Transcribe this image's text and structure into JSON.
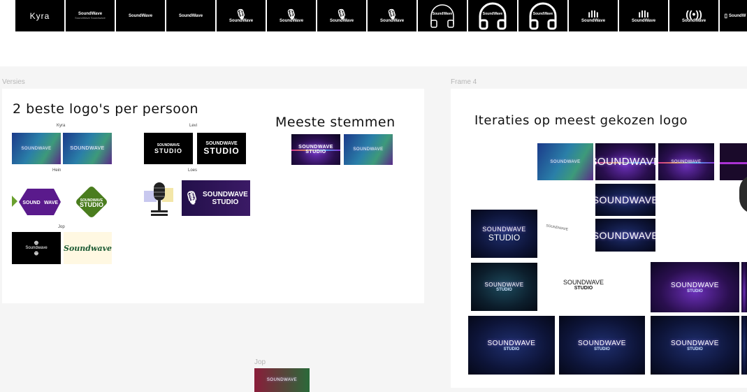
{
  "top_strip": {
    "tiles": [
      {
        "label": "Kyra"
      },
      {
        "label": "SoundWave",
        "sub": "SoundWave Soundwave"
      },
      {
        "label": "SoundWave"
      },
      {
        "label": "SoundWave"
      },
      {
        "label": "SoundWave",
        "icon": "mic-icon"
      },
      {
        "label": "SoundWave",
        "icon": "mic-icon"
      },
      {
        "label": "SoundWave",
        "icon": "mic-icon"
      },
      {
        "label": "SoundWave",
        "icon": "mic-icon"
      },
      {
        "label": "SoundWave",
        "icon": "headphones-icon"
      },
      {
        "label": "SoundWave",
        "icon": "headphones-icon"
      },
      {
        "label": "SoundWave",
        "icon": "headphones-icon"
      },
      {
        "label": "SoundWave",
        "icon": "waveform-icon"
      },
      {
        "label": "SoundWave",
        "icon": "waveform-icon"
      },
      {
        "label": "SoundWave",
        "icon": "broadcast-icon"
      },
      {
        "label": "SoundW",
        "icon": "speaker-icon"
      }
    ]
  },
  "frames": {
    "versies": {
      "label": "Versies",
      "heading": "2 beste logo's per persoon",
      "votes_heading": "Meeste stemmen",
      "people": {
        "kyra": "Kyra",
        "levi": "Levi",
        "hein": "Hein",
        "loes": "Loes",
        "jop": "Jop"
      },
      "logos": {
        "soundwave": "SOUNDWAVE",
        "studio": "STUDIO",
        "sound": "SOUND",
        "wave": "WAVE",
        "soundwave_lower": "Soundwave",
        "soundwave_studio": "SOUNDWAVE STUDIO"
      }
    },
    "frame4": {
      "label": "Frame 4",
      "heading": "Iteraties op meest gekozen logo",
      "logo_word": "SOUNDWAVE",
      "logo_sub": "STUDIO",
      "logo_word2": "SOUNDWAVE",
      "logo_sub2": "STUDIO"
    },
    "jop": {
      "label": "Jop"
    }
  }
}
